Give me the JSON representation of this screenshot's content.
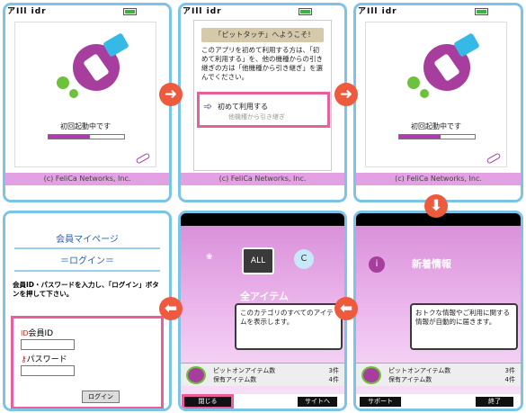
{
  "status": {
    "signal": "アIll idr"
  },
  "screen1": {
    "boot": "初回起動中です",
    "progress": 0.55,
    "footer": "(c) FeliCa Networks, Inc."
  },
  "screen2": {
    "title": "「ピットタッチ」へようこそ!",
    "text": "このアプリを初めて利用する方は、「初めて利用する」を、他の機種からの引き継ぎの方は「他機種から引き継ぎ」を選んでください。",
    "choice1": "初めて利用する",
    "choice2": "他機種から引き継ぎ",
    "footer": "(c) FeliCa Networks, Inc."
  },
  "screen3": {
    "boot": "初回起動中です",
    "progress": 0.55,
    "footer": "(c) FeliCa Networks, Inc."
  },
  "screen4": {
    "title": "会員マイページ",
    "login": "＝ログイン＝",
    "desc": "会員ID・パスワードを入力し、「ログイン」ボタンを押して下さい。",
    "id_label": "会員ID",
    "pw_label": "パスワード",
    "login_button": "ログイン"
  },
  "screen5": {
    "all": "ALL",
    "category": "全アイテム",
    "info": "このカテゴリのすべてのアイテムを表示します。",
    "stat1_label": "ピットオンアイテム数",
    "stat1_value": "3件",
    "stat2_label": "保有アイテム数",
    "stat2_value": "4件",
    "close": "閉じる",
    "site": "サイトへ"
  },
  "screen6": {
    "title": "新着情報",
    "info": "おトクな情報やご利用に関する情報が自動的に届きます。",
    "stat1_label": "ピットオンアイテム数",
    "stat1_value": "3件",
    "stat2_label": "保有アイテム数",
    "stat2_value": "4件",
    "support": "サポート",
    "end": "終了"
  }
}
